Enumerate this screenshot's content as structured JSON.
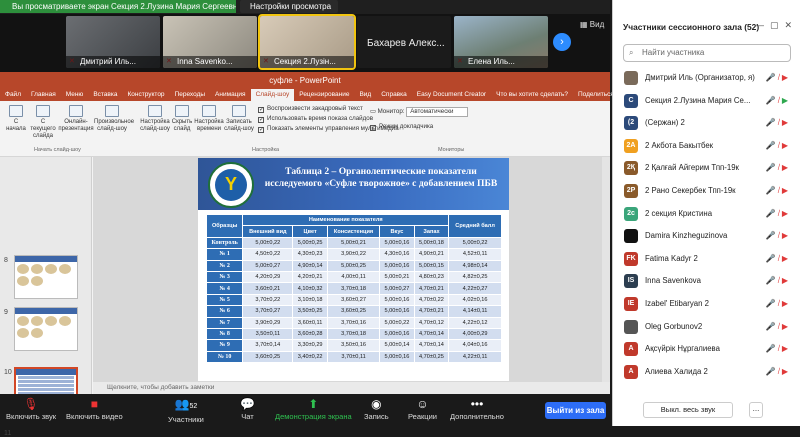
{
  "zoom": {
    "share_banner": "Вы просматриваете экран Секция 2.Лузина Мария Сергеевн...",
    "view_settings": "Настройки просмотра",
    "view_label": "Вид",
    "videos": [
      {
        "name": "Дмитрий Иль..."
      },
      {
        "name": "Inna Savenko..."
      },
      {
        "name": "Секция 2.Лузін..."
      },
      {
        "name": "Бахарев   Алекс..."
      },
      {
        "name": "Елена Иль..."
      }
    ],
    "toolbar": {
      "mute": "Включить звук",
      "video": "Включить видео",
      "participants": "Участники",
      "participants_count": "52",
      "chat": "Чат",
      "share": "Демонстрация экрана",
      "record": "Запись",
      "reactions": "Реакции",
      "more": "Дополнительно",
      "leave": "Выйти из зала"
    }
  },
  "ppt": {
    "window_title": "суфле  -  PowerPoint",
    "tabs": [
      "Файл",
      "Главная",
      "Меню",
      "Вставка",
      "Конструктор",
      "Переходы",
      "Анимация",
      "Слайд-шоу",
      "Рецензирование",
      "Вид",
      "Справка",
      "Easy Document Creator",
      "Что вы хотите сделать?",
      "Поделиться"
    ],
    "active_tab": "Слайд-шоу",
    "ribbon": {
      "buttons": [
        "С начала",
        "С текущего слайда",
        "Онлайн-презентация",
        "Произвольное слайд-шоу",
        "Настройка слайд-шоу",
        "Скрыть слайд",
        "Настройка времени",
        "Записать слайд-шоу"
      ],
      "checks": [
        "Воспроизвести закадровый текст",
        "Использовать время показа слайдов",
        "Показать элементы управления мультимедиа"
      ],
      "monitor_label": "Монитор:",
      "monitor_value": "Автоматически",
      "presenter_view": "Режим докладчика",
      "groups": [
        "Начать слайд-шоу",
        "Настройка",
        "Мониторы"
      ]
    },
    "slide_numbers": [
      "8",
      "9",
      "10",
      "11"
    ],
    "notes_placeholder": "Щелкните, чтобы добавить заметки",
    "slide": {
      "title": "Таблица 2 – Органолептические показатели исследуемого «Суфле творожное» с добавлением ПБВ",
      "header_group": "Наименование показателя",
      "header_avg": "Средний балл",
      "header_samples": "Образцы",
      "columns": [
        "Внешний вид",
        "Цвет",
        "Консистенция",
        "Вкус",
        "Запах"
      ],
      "rows": [
        {
          "label": "Контроль",
          "values": [
            "5,00±0,22",
            "5,00±0,25",
            "5,00±0,21",
            "5,00±0,16",
            "5,00±0,18",
            "5,00±0,22"
          ]
        },
        {
          "label": "№ 1",
          "values": [
            "4,50±0,22",
            "4,30±0,23",
            "3,90±0,22",
            "4,30±0,16",
            "4,90±0,21",
            "4,52±0,11"
          ]
        },
        {
          "label": "№ 2",
          "values": [
            "5,00±0,27",
            "4,90±0,14",
            "5,00±0,25",
            "5,00±0,16",
            "5,00±0,15",
            "4,98±0,14"
          ]
        },
        {
          "label": "№ 3",
          "values": [
            "4,20±0,29",
            "4,20±0,21",
            "4,00±0,11",
            "5,00±0,21",
            "4,80±0,23",
            "4,82±0,25"
          ]
        },
        {
          "label": "№ 4",
          "values": [
            "3,60±0,21",
            "4,10±0,32",
            "3,70±0,18",
            "5,00±0,27",
            "4,70±0,21",
            "4,22±0,27"
          ]
        },
        {
          "label": "№ 5",
          "values": [
            "3,70±0,22",
            "3,10±0,18",
            "3,60±0,27",
            "5,00±0,16",
            "4,70±0,22",
            "4,02±0,16"
          ]
        },
        {
          "label": "№ 6",
          "values": [
            "3,70±0,27",
            "3,50±0,25",
            "3,60±0,25",
            "5,00±0,16",
            "4,70±0,21",
            "4,14±0,11"
          ]
        },
        {
          "label": "№ 7",
          "values": [
            "3,90±0,29",
            "3,60±0,11",
            "3,70±0,16",
            "5,00±0,22",
            "4,70±0,12",
            "4,22±0,12"
          ]
        },
        {
          "label": "№ 8",
          "values": [
            "3,50±0,11",
            "3,60±0,28",
            "3,70±0,18",
            "5,00±0,16",
            "4,70±0,14",
            "4,00±0,29"
          ]
        },
        {
          "label": "№ 9",
          "values": [
            "3,70±0,14",
            "3,30±0,29",
            "3,50±0,16",
            "5,00±0,14",
            "4,70±0,14",
            "4,04±0,16"
          ]
        },
        {
          "label": "№ 10",
          "values": [
            "3,60±0,25",
            "3,40±0,22",
            "3,70±0,11",
            "5,00±0,16",
            "4,70±0,25",
            "4,22±0,11"
          ]
        }
      ]
    }
  },
  "panel": {
    "title": "Участники сессионного зала (52)",
    "search_placeholder": "Найти участника",
    "participants": [
      {
        "name": "Дмитрий Иль (Организатор, я)",
        "initials": "",
        "color": "#7a6a5a",
        "video_on": false
      },
      {
        "name": "Секция 2.Лузина Мария Се...",
        "initials": "С",
        "color": "#2c4a7a",
        "video_on": true
      },
      {
        "name": "(Сержан) 2",
        "initials": "(2",
        "color": "#2c4a7a",
        "video_on": false
      },
      {
        "name": "2 Акбота Бакытбек",
        "initials": "2А",
        "color": "#f0a020",
        "video_on": false
      },
      {
        "name": "2 Қалғай Айгерим Тпп-19к",
        "initials": "2Қ",
        "color": "#8a5a2a",
        "video_on": false
      },
      {
        "name": "2 Рано Секербек Тпп-19к",
        "initials": "2Р",
        "color": "#8a5a2a",
        "video_on": false
      },
      {
        "name": "2 секция Кристина",
        "initials": "2с",
        "color": "#3aa57a",
        "video_on": false
      },
      {
        "name": "Damira Kinzheguzinova",
        "initials": "",
        "color": "#111111",
        "video_on": false
      },
      {
        "name": "Fatima Kadyr 2",
        "initials": "FK",
        "color": "#c0392b",
        "video_on": false
      },
      {
        "name": "Inna Savenkova",
        "initials": "IS",
        "color": "#2c3e50",
        "video_on": false
      },
      {
        "name": "Izabel' Etibaryan 2",
        "initials": "IE",
        "color": "#c0392b",
        "video_on": false
      },
      {
        "name": "Oleg Gorbunov2",
        "initials": "",
        "color": "#555555",
        "video_on": false
      },
      {
        "name": "Ақсүйрік Нұргалиева",
        "initials": "А",
        "color": "#c0392b",
        "video_on": false
      },
      {
        "name": "Алиева Халида 2",
        "initials": "А",
        "color": "#c0392b",
        "video_on": false
      }
    ],
    "mute_all": "Выкл. весь звук",
    "more": "..."
  }
}
